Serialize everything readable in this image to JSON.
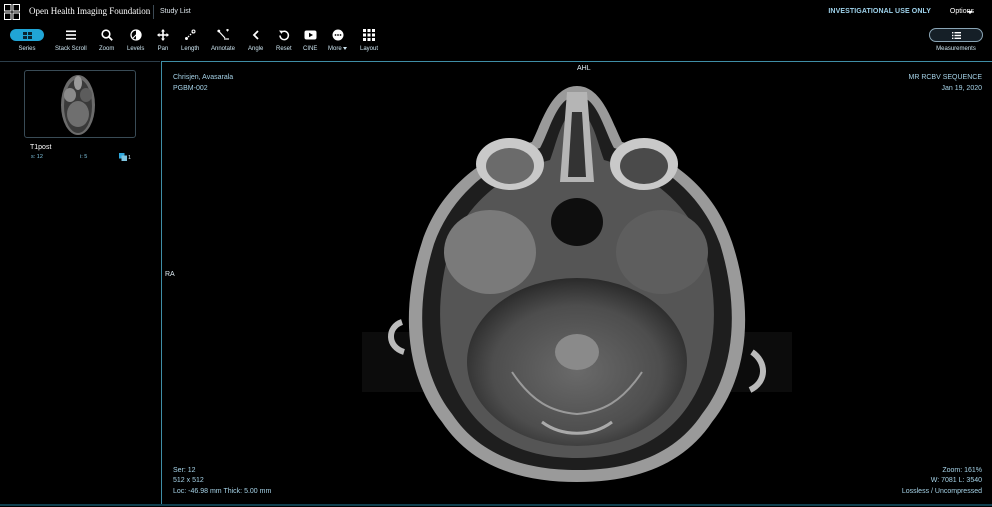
{
  "header": {
    "brand": "Open Health Imaging Foundation",
    "study_list": "Study List",
    "investigational": "INVESTIGATIONAL USE ONLY",
    "options": "Options"
  },
  "toolbar": {
    "series": "Series",
    "stack_scroll": "Stack Scroll",
    "zoom": "Zoom",
    "levels": "Levels",
    "pan": "Pan",
    "length": "Length",
    "annotate": "Annotate",
    "angle": "Angle",
    "reset": "Reset",
    "cine": "CINE",
    "more": "More",
    "layout": "Layout",
    "measurements": "Measurements"
  },
  "sidebar": {
    "series": [
      {
        "description": "T1post",
        "series_number": "s: 12",
        "instances": "i: 5",
        "count": "1"
      }
    ]
  },
  "viewport": {
    "patient_name": "Chrisjen, Avasarala",
    "patient_id": "PGBM-002",
    "series_description": "MR RCBV SEQUENCE",
    "study_date": "Jan 19, 2020",
    "series_number": "Ser: 12",
    "dimensions": "512 x 512",
    "location": "Loc: -46.98 mm Thick: 5.00 mm",
    "zoom": "Zoom: 161%",
    "window_level": "W: 7081 L: 3540",
    "compression": "Lossless / Uncompressed",
    "orientation_top": "AHL",
    "orientation_left": "RA"
  },
  "colors": {
    "accent": "#20a5d6",
    "viewport_border": "#3f8ea6",
    "overlay_text": "#a6d3e8"
  },
  "icons": [
    "logo-icon",
    "series-icon",
    "stack-scroll-icon",
    "zoom-icon",
    "levels-icon",
    "pan-icon",
    "length-icon",
    "annotate-icon",
    "angle-icon",
    "reset-icon",
    "cine-icon",
    "more-icon",
    "layout-icon",
    "measurements-icon",
    "stack-icon"
  ]
}
